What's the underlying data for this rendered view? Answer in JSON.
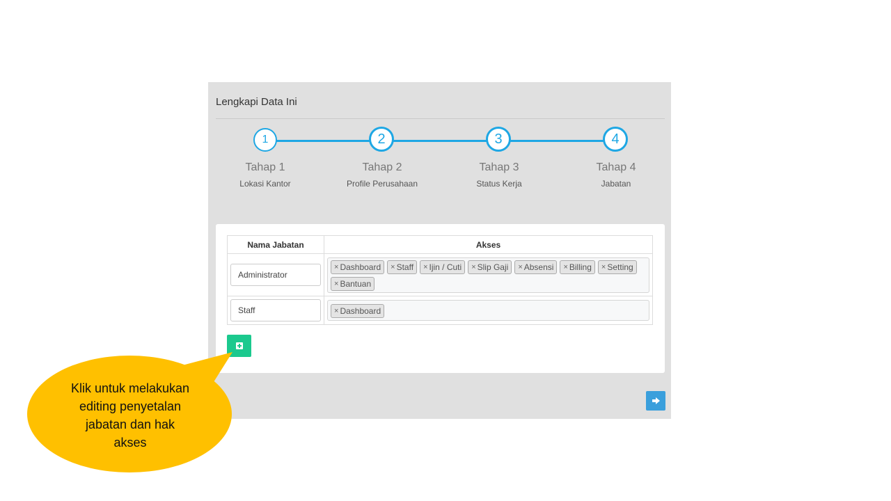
{
  "panel": {
    "title": "Lengkapi Data Ini"
  },
  "stepper": {
    "steps": [
      {
        "number": "1",
        "title": "Tahap 1",
        "subtitle": "Lokasi Kantor"
      },
      {
        "number": "2",
        "title": "Tahap 2",
        "subtitle": "Profile Perusahaan"
      },
      {
        "number": "3",
        "title": "Tahap 3",
        "subtitle": "Status Kerja"
      },
      {
        "number": "4",
        "title": "Tahap 4",
        "subtitle": "Jabatan"
      }
    ],
    "accent_color": "#1ea7e4"
  },
  "table": {
    "headers": {
      "name": "Nama Jabatan",
      "access": "Akses"
    },
    "rows": [
      {
        "name": "Administrator",
        "tags": [
          "Dashboard",
          "Staff",
          "Ijin / Cuti",
          "Slip Gaji",
          "Absensi",
          "Billing",
          "Setting",
          "Bantuan"
        ]
      },
      {
        "name": "Staff",
        "tags": [
          "Dashboard"
        ]
      }
    ],
    "tag_remove_symbol": "×"
  },
  "buttons": {
    "add_icon": "plus-square-icon",
    "add_color": "#1bc98e",
    "next_icon": "arrow-right-icon",
    "next_color": "#3a9fdc"
  },
  "callout": {
    "lines": [
      "Klik untuk melakukan",
      "editing penyetalan",
      "jabatan dan hak",
      "akses"
    ],
    "color": "#ffc000"
  }
}
